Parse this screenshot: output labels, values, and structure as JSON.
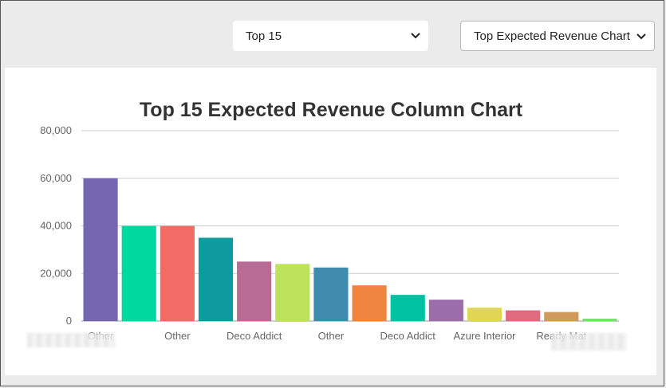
{
  "controls": {
    "top_select": {
      "value": "Top 15"
    },
    "chart_select": {
      "value": "Top Expected Revenue Chart"
    }
  },
  "chart_data": {
    "type": "bar",
    "title": "Top 15 Expected Revenue Column Chart",
    "xlabel": "",
    "ylabel": "",
    "ylim": [
      0,
      80000
    ],
    "yticks": [
      "0",
      "20,000",
      "40,000",
      "60,000",
      "80,000"
    ],
    "grid": true,
    "categories": [
      "Other",
      "",
      "Other",
      "",
      "Deco Addict",
      "",
      "Other",
      "",
      "Deco Addict",
      "",
      "Azure Interior",
      "",
      "Ready Mat",
      ""
    ],
    "values": [
      60000,
      40000,
      40000,
      35000,
      25000,
      24000,
      22500,
      15000,
      11000,
      9000,
      5600,
      4500,
      3800,
      1000
    ],
    "colors": [
      "#7467b0",
      "#00d89f",
      "#f16c65",
      "#0d9b9d",
      "#b86b93",
      "#bde25b",
      "#3f8bad",
      "#ef8640",
      "#00c2a3",
      "#9b6ea9",
      "#e1d556",
      "#de6c7e",
      "#cf9a5c",
      "#7fdc75"
    ]
  }
}
